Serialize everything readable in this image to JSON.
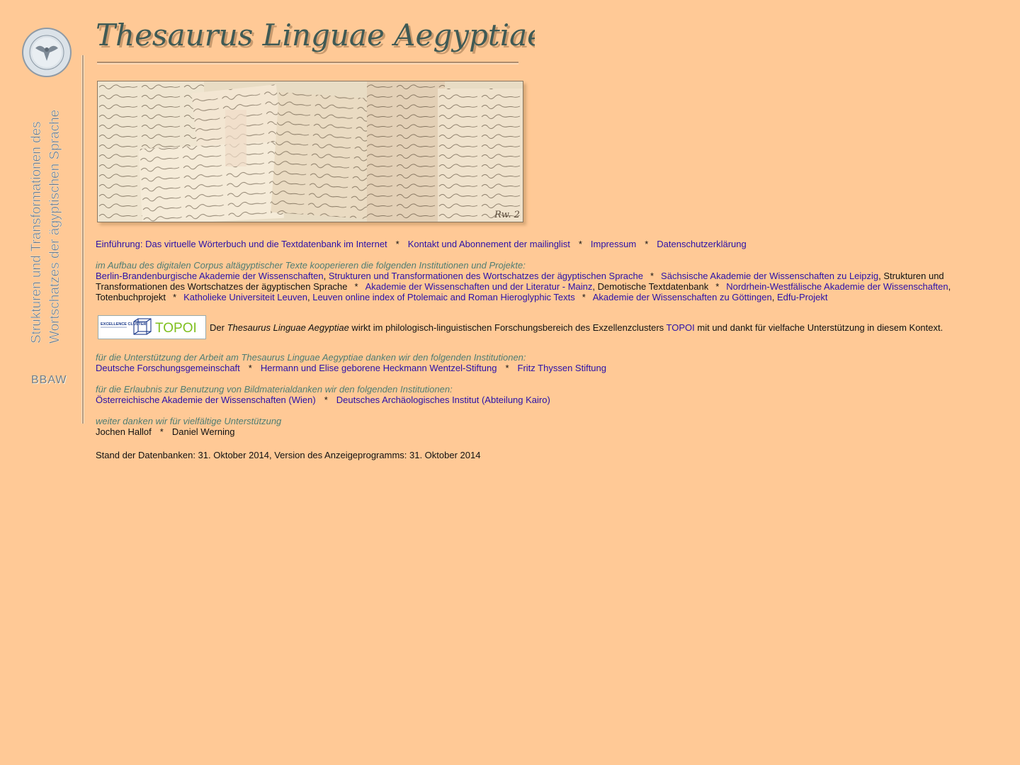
{
  "title": "Thesaurus Linguae Aegyptiae",
  "sidebar": {
    "vertical_line1": "Strukturen und Transformationen des",
    "vertical_line2": "Wortschatzes der ägyptischen Sprache",
    "bbaw": "BBAW"
  },
  "photo_caption": "Rw. 2",
  "nav": {
    "items": [
      "Einführung: Das virtuelle Wörterbuch und die Textdatenbank im Internet",
      "Kontakt und Abonnement der mailinglist",
      "Impressum",
      "Datenschutzerklärung"
    ],
    "separator": "*"
  },
  "cooperation": {
    "intro": "im Aufbau des digitalen Corpus altägyptischer Texte kooperieren die folgenden Institutionen und Projekte:",
    "link1": "Berlin-Brandenburgische Akademie der Wissenschaften",
    "comma": ",",
    "link2": "Strukturen und Transformationen des Wortschatzes der ägyptischen Sprache",
    "link3": "Sächsische Akademie der Wissenschaften zu Leipzig",
    "text3": ", Strukturen und Transformationen des Wortschatzes der ägyptischen Sprache",
    "link4": "Akademie der Wissenschaften und der Literatur - Mainz",
    "text4": ", Demotische Textdatenbank",
    "link5": "Nordrhein-Westfälische Akademie der Wissenschaften",
    "text5": ", Totenbuchprojekt",
    "link6": "Katholieke Universiteit Leuven",
    "link7": "Leuven online index of Ptolemaic and Roman Hieroglyphic Texts",
    "link8": "Akademie der Wissenschaften zu Göttingen",
    "link9": "Edfu-Projekt"
  },
  "topoi": {
    "logo_small": "EXCELLENCE CLUSTER",
    "logo_big": "TOPOI",
    "text_before": "Der ",
    "text_em": "Thesaurus Linguae Aegyptiae",
    "text_mid": " wirkt im philologisch-linguistischen Forschungsbereich des Exzellenzclusters ",
    "link": "TOPOI",
    "text_after": " mit und dankt für vielfache Unterstützung in diesem Kontext."
  },
  "support": {
    "intro": "für die Unterstützung der Arbeit am Thesaurus Linguae Aegyptiae danken wir den folgenden Institutionen:",
    "links": [
      "Deutsche Forschungsgemeinschaft",
      "Hermann und Elise geborene Heckmann Wentzel-Stiftung",
      "Fritz Thyssen Stiftung"
    ]
  },
  "images": {
    "intro": "für die Erlaubnis zur Benutzung von Bildmaterialdanken wir den folgenden Institutionen:",
    "links": [
      "Österreichische Akademie der Wissenschaften (Wien)",
      "Deutsches Archäologisches Institut (Abteilung Kairo)"
    ]
  },
  "thanks": {
    "intro": "weiter danken wir für vielfältige Unterstützung",
    "names": [
      "Jochen Hallof",
      "Daniel Werning"
    ]
  },
  "footer": "Stand der Datenbanken: 31. Oktober 2014, Version des Anzeigeprogramms: 31. Oktober 2014",
  "colors": {
    "background": "#ffc996",
    "link": "#2a10a8",
    "italic_intro": "#4e7d73",
    "title": "#3f5a55"
  }
}
